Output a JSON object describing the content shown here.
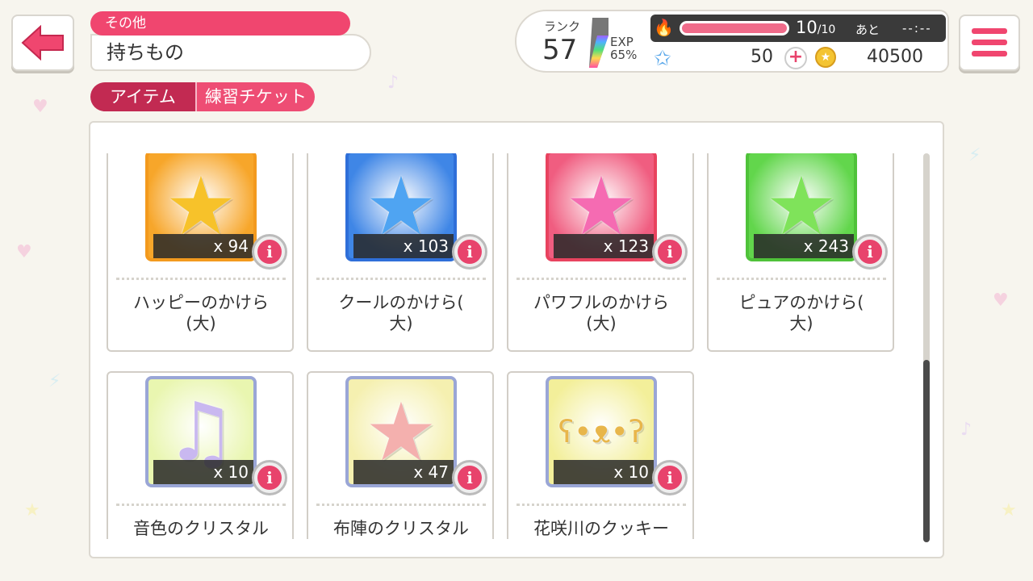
{
  "header": {
    "category": "その他",
    "title": "持ちもの"
  },
  "tabs": [
    {
      "label": "アイテム",
      "active": true
    },
    {
      "label": "練習チケット",
      "active": false
    }
  ],
  "status": {
    "rank_label": "ランク",
    "rank_value": "57",
    "exp_label": "EXP",
    "exp_percent": "65%",
    "energy_current": "10",
    "energy_max": "/10",
    "energy_fraction": 1.0,
    "ato_label": "あと",
    "ato_time": "--:--",
    "star_count": "50",
    "coin_count": "40500"
  },
  "items": [
    {
      "name": "ハッピーのかけら\n(大)",
      "count": "x 94",
      "frame": "#f39a1e",
      "bg": "#f7a62a",
      "glyph": "★",
      "glyph_color": "#f7c22a",
      "face": "☺"
    },
    {
      "name": "クールのかけら(\n大)",
      "count": "x 103",
      "frame": "#2f6fd9",
      "bg": "#3f86e6",
      "glyph": "★",
      "glyph_color": "#4fa4f2",
      "face": "☾"
    },
    {
      "name": "パワフルのかけら\n(大)",
      "count": "x 123",
      "frame": "#e8435f",
      "bg": "#f05d80",
      "glyph": "★",
      "glyph_color": "#f56bb2",
      "face": "♨"
    },
    {
      "name": "ピュアのかけら(\n大)",
      "count": "x 243",
      "frame": "#4fc23a",
      "bg": "#62d64c",
      "glyph": "★",
      "glyph_color": "#7fe35a",
      "face": "✦"
    },
    {
      "name": "音色のクリスタル",
      "count": "x 10",
      "frame": "#9aa6d6",
      "bg": "#e9f6b0",
      "glyph": "♫",
      "glyph_color": "#c9b8f0",
      "face": ""
    },
    {
      "name": "布陣のクリスタル",
      "count": "x 47",
      "frame": "#9aa6d6",
      "bg": "#f5f0b0",
      "glyph": "★",
      "glyph_color": "#f4b0ae",
      "face": ""
    },
    {
      "name": "花咲川のクッキー",
      "count": "x 10",
      "frame": "#9aa6d6",
      "bg": "#f3ef9a",
      "glyph": "ʕ•ᴥ•ʔ",
      "glyph_color": "#e8b64a",
      "face": ""
    }
  ]
}
